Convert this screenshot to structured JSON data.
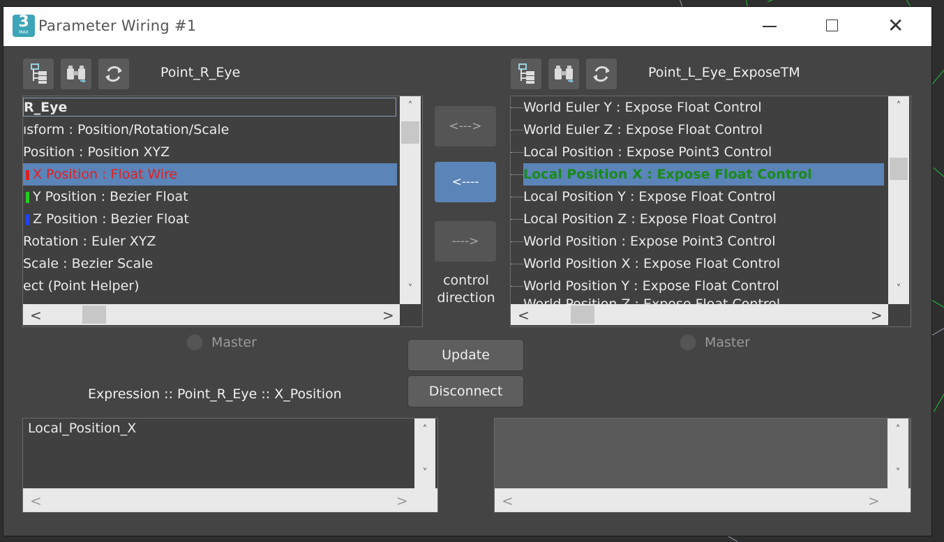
{
  "window": {
    "title": "Parameter Wiring #1",
    "app_icon_text": "3",
    "app_icon_sub": "MAX",
    "minimize_glyph": "—",
    "maximize_glyph": "☐",
    "close_glyph": "✕"
  },
  "left_panel": {
    "object_name": "Point_R_Eye",
    "toolbar_icons": [
      "hierarchy-icon",
      "binoculars-find-icon",
      "refresh-icon"
    ],
    "tree_items": [
      {
        "label": "R_Eye",
        "style": "bold-boxed"
      },
      {
        "label": "ısform : Position/Rotation/Scale",
        "style": "normal"
      },
      {
        "label": "Position : Position XYZ",
        "style": "normal"
      },
      {
        "label": "X Position : Float Wire",
        "style": "selected-wired",
        "marker_color": "#e02020"
      },
      {
        "label": "Y Position : Bezier Float",
        "style": "normal",
        "marker_color": "#22cc22"
      },
      {
        "label": "Z Position : Bezier Float",
        "style": "normal",
        "marker_color": "#2244ee"
      },
      {
        "label": "Rotation : Euler XYZ",
        "style": "normal"
      },
      {
        "label": "Scale : Bezier Scale",
        "style": "normal"
      },
      {
        "label": "ect (Point Helper)",
        "style": "normal"
      }
    ],
    "master_label": "Master"
  },
  "right_panel": {
    "object_name": "Point_L_Eye_ExposeTM",
    "toolbar_icons": [
      "hierarchy-icon",
      "binoculars-find-icon",
      "refresh-icon"
    ],
    "tree_items": [
      {
        "label": "World Euler Y : Expose Float Control",
        "style": "normal"
      },
      {
        "label": "World Euler Z : Expose Float Control",
        "style": "normal"
      },
      {
        "label": "Local Position : Expose Point3 Control",
        "style": "normal"
      },
      {
        "label": "Local Position X : Expose Float Control",
        "style": "selected-wired"
      },
      {
        "label": "Local Position Y : Expose Float Control",
        "style": "normal"
      },
      {
        "label": "Local Position Z : Expose Float Control",
        "style": "normal"
      },
      {
        "label": "World Position : Expose Point3 Control",
        "style": "normal"
      },
      {
        "label": "World Position X : Expose Float Control",
        "style": "normal"
      },
      {
        "label": "World Position Y : Expose Float Control",
        "style": "normal"
      },
      {
        "label": "World Position Z : Expose Float Control",
        "style": "cut-off"
      }
    ],
    "master_label": "Master"
  },
  "control_direction": {
    "buttons": [
      {
        "label": "<--->",
        "active": false
      },
      {
        "label": "<----",
        "active": true
      },
      {
        "label": "---->",
        "active": false
      }
    ],
    "caption_line1": "control",
    "caption_line2": "direction"
  },
  "actions": {
    "update_label": "Update",
    "disconnect_label": "Disconnect"
  },
  "expression": {
    "label": "Expression :: Point_R_Eye :: X_Position",
    "left_text": "Local_Position_X",
    "right_text": ""
  },
  "colors": {
    "selection": "#5b84b8",
    "wired_left_text": "#e02020",
    "wired_right_text": "#1a8a1a",
    "panel_bg": "#444444",
    "viewport_green": "#22c43a"
  },
  "scrollbars": {
    "up_arrow": "˄",
    "down_arrow": "˅",
    "left_arrow": "<",
    "right_arrow": ">"
  }
}
